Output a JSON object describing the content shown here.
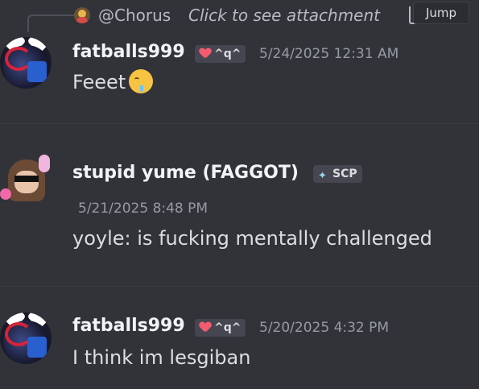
{
  "reply": {
    "author": "@Chorus",
    "preview": "Click to see attachment",
    "icon": "attachment-icon"
  },
  "jump_label": "Jump",
  "messages": [
    {
      "author": "fatballs999",
      "tag": "^q^",
      "tag_icon": "heart-icon",
      "timestamp": "5/24/2025 12:31 AM",
      "text": "Feeet",
      "emoji": "drooling-face-emoji"
    },
    {
      "author": "stupid yume (FAGGOT)",
      "tag": "SCP",
      "tag_icon": "gem-icon",
      "timestamp": "5/21/2025 8:48 PM",
      "text": "yoyle: is fucking mentally challenged"
    },
    {
      "author": "fatballs999",
      "tag": "^q^",
      "tag_icon": "heart-icon",
      "timestamp": "5/20/2025 4:32 PM",
      "text": "I think im lesgiban"
    }
  ],
  "colors": {
    "background": "#323339",
    "name": "#f2f3f5",
    "timestamp": "#949ba4",
    "text": "#dbdee1"
  }
}
